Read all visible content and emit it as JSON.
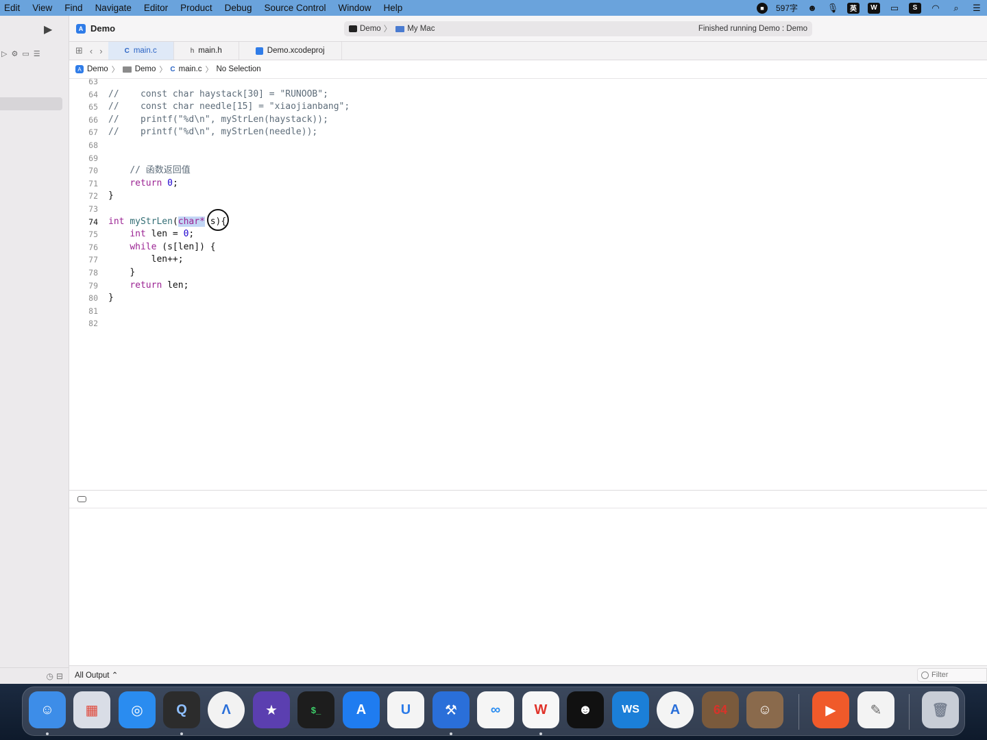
{
  "menubar": {
    "items": [
      "Edit",
      "View",
      "Find",
      "Navigate",
      "Editor",
      "Product",
      "Debug",
      "Source Control",
      "Window",
      "Help"
    ],
    "word_count": "597字",
    "input_method": "英"
  },
  "toolbar": {
    "project_title": "Demo",
    "scheme": "Demo",
    "destination": "My Mac",
    "status": "Finished running Demo : Demo"
  },
  "tabs": [
    {
      "icon": "C",
      "label": "main.c",
      "active": true
    },
    {
      "icon": "h",
      "label": "main.h",
      "active": false
    },
    {
      "icon": "proj",
      "label": "Demo.xcodeproj",
      "active": false
    }
  ],
  "jumpbar": {
    "project": "Demo",
    "group": "Demo",
    "file_icon": "C",
    "file": "main.c",
    "selection": "No Selection"
  },
  "editor": {
    "current_line": 74,
    "lines": [
      {
        "n": "63"
      },
      {
        "n": "64"
      },
      {
        "n": "65"
      },
      {
        "n": "66"
      },
      {
        "n": "67"
      },
      {
        "n": "68"
      },
      {
        "n": "69"
      },
      {
        "n": "70"
      },
      {
        "n": "71"
      },
      {
        "n": "72"
      },
      {
        "n": "73"
      },
      {
        "n": "74"
      },
      {
        "n": "75"
      },
      {
        "n": "76"
      },
      {
        "n": "77"
      },
      {
        "n": "78"
      },
      {
        "n": "79"
      },
      {
        "n": "80"
      },
      {
        "n": "81"
      },
      {
        "n": "82"
      }
    ],
    "code": {
      "l64": "//    const char haystack[30] = \"RUNOOB\";",
      "l65": "//    const char needle[15] = \"xiaojianbang\";",
      "l66": "//    printf(\"%d\\n\", myStrLen(haystack));",
      "l67": "//    printf(\"%d\\n\", myStrLen(needle));",
      "l70_comment": "// 函数返回值",
      "l71_kw": "return",
      "l71_num": "0",
      "l71_rest": ";",
      "l72": "}",
      "l74_kw": "int",
      "l74_fn": "myStrLen",
      "l74_open": "(",
      "l74_sel": "char*",
      "l74_rest": " s){",
      "l75_kw": "int",
      "l75_mid": " len = ",
      "l75_num": "0",
      "l75_end": ";",
      "l76_kw": "while",
      "l76_rest": " (s[len]) {",
      "l77": "len++;",
      "l78": "}",
      "l79_kw": "return",
      "l79_rest": " len;",
      "l80": "}"
    }
  },
  "console": {
    "output_filter": "All Output ⌃",
    "filter_placeholder": "Filter"
  },
  "dock": {
    "badge_text": "64",
    "apps": [
      {
        "name": "finder",
        "color": "#3d8de8"
      },
      {
        "name": "launchpad",
        "color": "#d9dde6"
      },
      {
        "name": "safari",
        "color": "#2a8cf0"
      },
      {
        "name": "quicktime",
        "color": "#2c2c2c"
      },
      {
        "name": "instruments",
        "color": "#f2f2f2"
      },
      {
        "name": "imovie",
        "color": "#5b3fb0"
      },
      {
        "name": "terminal",
        "color": "#1d1d1d"
      },
      {
        "name": "app-store",
        "color": "#1f7cf0"
      },
      {
        "name": "uniapp",
        "color": "#f4f4f4"
      },
      {
        "name": "xcode",
        "color": "#2a6fd9"
      },
      {
        "name": "baidu-netdisk",
        "color": "#f5f5f5"
      },
      {
        "name": "wps",
        "color": "#f7f7f7"
      },
      {
        "name": "qq",
        "color": "#111111"
      },
      {
        "name": "webstorm",
        "color": "#1b7fd8"
      },
      {
        "name": "android-studio",
        "color": "#f4f4f4"
      },
      {
        "name": "portrait-app-1",
        "color": "#7a5a3c"
      },
      {
        "name": "portrait-app-2",
        "color": "#8a6a4c"
      },
      {
        "name": "infuse",
        "color": "#f05a2a"
      },
      {
        "name": "textedit",
        "color": "#f3f3f3"
      },
      {
        "name": "trash",
        "color": "#c8cdd6"
      }
    ]
  },
  "colors": {
    "menubar": "#6aa3dc",
    "selection": "#c2d6f5",
    "keyword": "#9b2393",
    "function": "#326d74",
    "number": "#1c00cf",
    "comment": "#5d6c79"
  }
}
